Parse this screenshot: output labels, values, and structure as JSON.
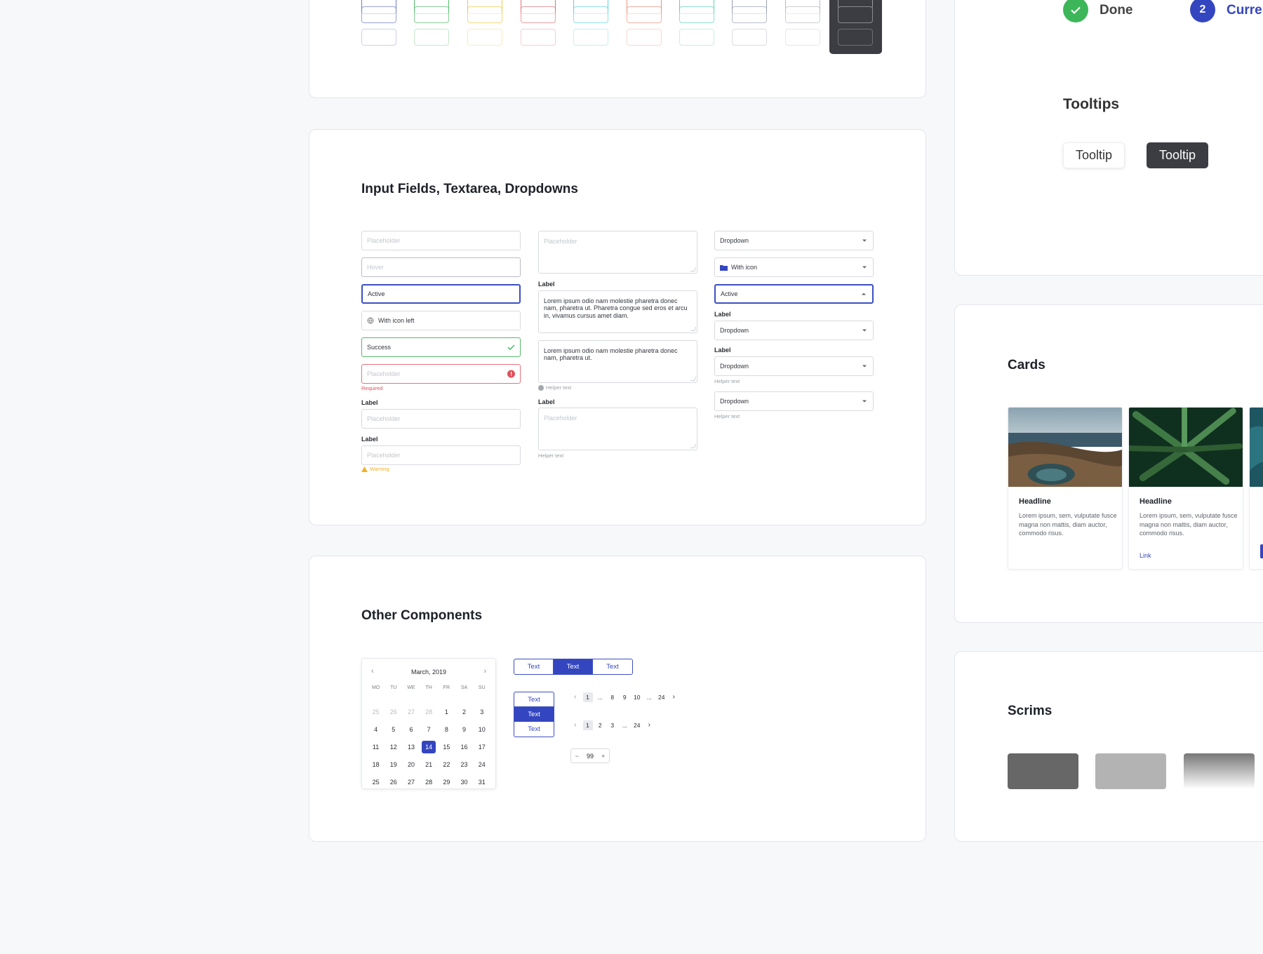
{
  "colors": {
    "accent": "#3446bf",
    "success": "#3cb658",
    "error": "#e0505c",
    "warning": "#f0b12a"
  },
  "inputs_section": {
    "title": "Input Fields, Textarea, Dropdowns",
    "col1": {
      "placeholder": "Placeholder",
      "hover": "Hover",
      "active": "Active",
      "with_icon_left": "With icon left",
      "success": "Success",
      "error_placeholder": "Placeholder",
      "required": "Required",
      "label1": "Label",
      "labelled_placeholder1": "Placeholder",
      "label2": "Label",
      "labelled_placeholder2": "Placeholder",
      "warning": "Warning"
    },
    "col2": {
      "textarea_placeholder": "Placeholder",
      "label1": "Label",
      "textarea1_value": "Lorem ipsum odio nam molestie pharetra donec nam, pharetra ut. Pharetra congue sed eros et arcu in, vivamus cursus amet diam.",
      "textarea2_value": "Lorem ipsum odio nam molestie pharetra donec nam, pharetra ut.",
      "helper1": "Helper text",
      "label2": "Label",
      "textarea3_placeholder": "Placeholder",
      "helper2": "Helper text"
    },
    "col3": {
      "dropdown1": "Dropdown",
      "with_icon": "With icon",
      "active": "Active",
      "label1": "Label",
      "dropdown2": "Dropdown",
      "label2": "Label",
      "dropdown3": "Dropdown",
      "helper1": "Helper text",
      "dropdown4": "Dropdown",
      "helper2": "Helper text"
    }
  },
  "other_section": {
    "title": "Other Components",
    "calendar": {
      "month": "March, 2019",
      "weekdays": [
        "MO",
        "TU",
        "WE",
        "TH",
        "FR",
        "SA",
        "SU"
      ],
      "days": [
        {
          "d": "25",
          "m": true
        },
        {
          "d": "26",
          "m": true
        },
        {
          "d": "27",
          "m": true
        },
        {
          "d": "28",
          "m": true
        },
        {
          "d": "1"
        },
        {
          "d": "2"
        },
        {
          "d": "3"
        },
        {
          "d": "4"
        },
        {
          "d": "5"
        },
        {
          "d": "6"
        },
        {
          "d": "7"
        },
        {
          "d": "8"
        },
        {
          "d": "9"
        },
        {
          "d": "10"
        },
        {
          "d": "11"
        },
        {
          "d": "12"
        },
        {
          "d": "13"
        },
        {
          "d": "14",
          "s": true
        },
        {
          "d": "15"
        },
        {
          "d": "16"
        },
        {
          "d": "17"
        },
        {
          "d": "18"
        },
        {
          "d": "19"
        },
        {
          "d": "20"
        },
        {
          "d": "21"
        },
        {
          "d": "22"
        },
        {
          "d": "23"
        },
        {
          "d": "24"
        },
        {
          "d": "25"
        },
        {
          "d": "26"
        },
        {
          "d": "27"
        },
        {
          "d": "28"
        },
        {
          "d": "29"
        },
        {
          "d": "30"
        },
        {
          "d": "31"
        }
      ]
    },
    "segmented_h": [
      "Text",
      "Text",
      "Text"
    ],
    "segmented_v": [
      "Text",
      "Text",
      "Text"
    ],
    "pager1": [
      "1",
      "...",
      "8",
      "9",
      "10",
      "...",
      "24"
    ],
    "pager2": [
      "1",
      "2",
      "3",
      "...",
      "24"
    ],
    "stepper": {
      "minus": "−",
      "value": "99",
      "plus": "+"
    }
  },
  "right": {
    "steps": {
      "done_label": "Done",
      "current_number": "2",
      "current_label": "Current"
    },
    "tooltips": {
      "title": "Tooltips",
      "light": "Tooltip",
      "dark": "Tooltip"
    },
    "cards": {
      "title": "Cards",
      "items": [
        {
          "headline": "Headline",
          "body": "Lorem ipsum, sem, vulputate fusce magna non mattis, diam auctor, commodo risus.",
          "link": ""
        },
        {
          "headline": "Headline",
          "body": "Lorem ipsum, sem, vulputate fusce magna non mattis, diam auctor, commodo risus.",
          "link": "Link"
        }
      ]
    },
    "scrims": {
      "title": "Scrims"
    }
  },
  "icons": [
    "globe-icon",
    "check-icon",
    "error-icon",
    "warning-icon",
    "info-icon",
    "folder-icon",
    "chevron-left-icon",
    "chevron-right-icon",
    "check-circle-icon"
  ]
}
